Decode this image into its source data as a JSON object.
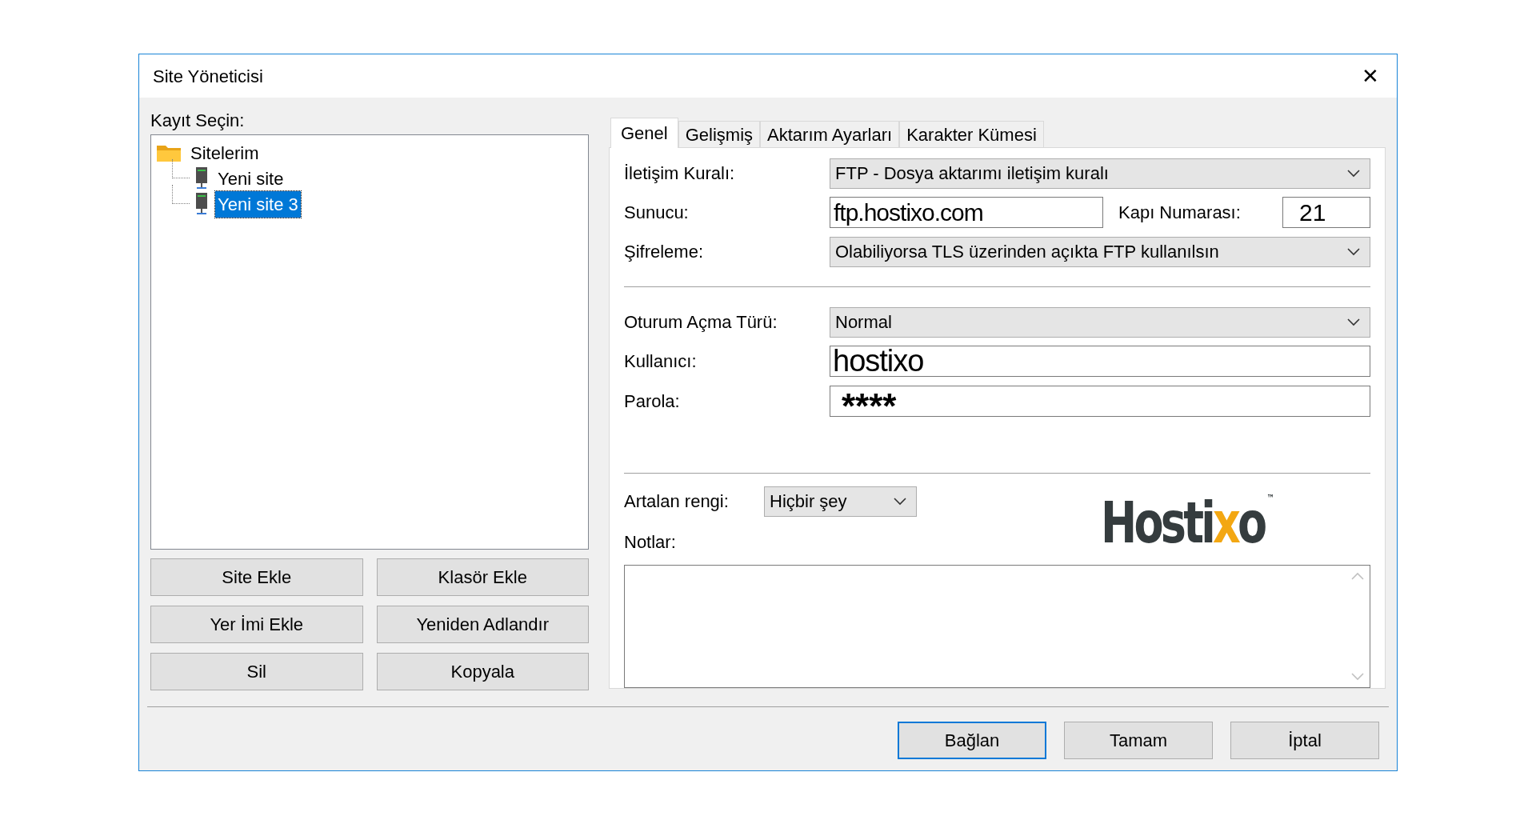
{
  "window": {
    "title": "Site Yöneticisi",
    "close": "✕"
  },
  "tree": {
    "label": "Kayıt Seçin:",
    "items": [
      {
        "text": "Sitelerim",
        "kind": "folder",
        "selected": false,
        "children": [
          {
            "text": "Yeni site",
            "kind": "site",
            "selected": false
          },
          {
            "text": "Yeni site 3",
            "kind": "site",
            "selected": true
          }
        ]
      }
    ]
  },
  "left_buttons": [
    "Site Ekle",
    "Klasör Ekle",
    "Yer İmi Ekle",
    "Yeniden Adlandır",
    "Sil",
    "Kopyala"
  ],
  "tabs": [
    {
      "label": "Genel",
      "selected": true
    },
    {
      "label": "Gelişmiş",
      "selected": false
    },
    {
      "label": "Aktarım Ayarları",
      "selected": false
    },
    {
      "label": "Karakter Kümesi",
      "selected": false
    }
  ],
  "general": {
    "protocol": {
      "label": "İletişim Kuralı:",
      "value": "FTP - Dosya aktarımı iletişim kuralı"
    },
    "host": {
      "label": "Sunucu:",
      "value": "ftp.hostixo.com"
    },
    "port": {
      "label": "Kapı Numarası:",
      "value": "21"
    },
    "encryption": {
      "label": "Şifreleme:",
      "value": "Olabiliyorsa TLS üzerinden açıkta FTP kullanılsın"
    },
    "logon_type": {
      "label": "Oturum Açma Türü:",
      "value": "Normal"
    },
    "user": {
      "label": "Kullanıcı:",
      "value": "hostixo"
    },
    "password": {
      "label": "Parola:",
      "value": "****"
    },
    "background_color": {
      "label": "Artalan rengi:",
      "value": "Hiçbir şey"
    },
    "logo": {
      "parts": [
        {
          "text": "Hosti",
          "accent": false
        },
        {
          "text": "x",
          "accent": true
        },
        {
          "text": "o",
          "accent": false
        }
      ],
      "trademark": "™"
    },
    "notes": {
      "label": "Notlar:"
    }
  },
  "bottom_buttons": [
    {
      "label": "Bağlan",
      "default": true
    },
    {
      "label": "Tamam",
      "default": false
    },
    {
      "label": "İptal",
      "default": false
    }
  ]
}
